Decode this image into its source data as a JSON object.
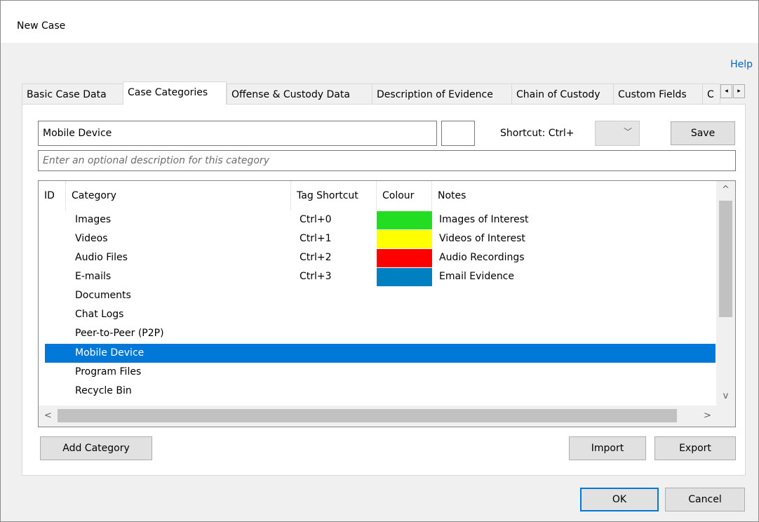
{
  "window": {
    "title": "New Case",
    "help_label": "Help"
  },
  "tabs": [
    {
      "label": "Basic Case Data"
    },
    {
      "label": "Case Categories",
      "active": true
    },
    {
      "label": "Offense & Custody Data"
    },
    {
      "label": "Description of Evidence"
    },
    {
      "label": "Chain of Custody"
    },
    {
      "label": "Custom Fields"
    },
    {
      "label": "C"
    }
  ],
  "tab_scroll": {
    "left": "◂",
    "right": "▸"
  },
  "editor": {
    "category_name": "Mobile Device",
    "description_placeholder": "Enter an optional description for this category",
    "shortcut_label": "Shortcut:  Ctrl+",
    "shortcut_value": "",
    "save_label": "Save"
  },
  "table": {
    "columns": [
      "ID",
      "Category",
      "Tag Shortcut",
      "Colour",
      "Notes"
    ],
    "rows": [
      {
        "id": "",
        "category": "Images",
        "shortcut": "Ctrl+0",
        "colour": "#22dd22",
        "notes": "Images of Interest"
      },
      {
        "id": "",
        "category": "Videos",
        "shortcut": "Ctrl+1",
        "colour": "#ffff00",
        "notes": "Videos of Interest"
      },
      {
        "id": "",
        "category": "Audio Files",
        "shortcut": "Ctrl+2",
        "colour": "#ff0000",
        "notes": "Audio Recordings"
      },
      {
        "id": "",
        "category": "E-mails",
        "shortcut": "Ctrl+3",
        "colour": "#0080c0",
        "notes": "Email Evidence"
      },
      {
        "id": "",
        "category": "Documents",
        "shortcut": "",
        "colour": "",
        "notes": ""
      },
      {
        "id": "",
        "category": "Chat Logs",
        "shortcut": "",
        "colour": "",
        "notes": ""
      },
      {
        "id": "",
        "category": "Peer-to-Peer (P2P)",
        "shortcut": "",
        "colour": "",
        "notes": ""
      },
      {
        "id": "",
        "category": "Mobile Device",
        "shortcut": "",
        "colour": "",
        "notes": "",
        "selected": true
      },
      {
        "id": "",
        "category": "Program Files",
        "shortcut": "",
        "colour": "",
        "notes": ""
      },
      {
        "id": "",
        "category": "Recycle Bin",
        "shortcut": "",
        "colour": "",
        "notes": ""
      }
    ]
  },
  "scroll": {
    "up": "^",
    "down": "v",
    "left": "<",
    "right": ">"
  },
  "buttons": {
    "add_category": "Add Category",
    "import": "Import",
    "export": "Export",
    "ok": "OK",
    "cancel": "Cancel"
  },
  "colors": {
    "selection": "#0078d7",
    "link": "#0066cc"
  }
}
